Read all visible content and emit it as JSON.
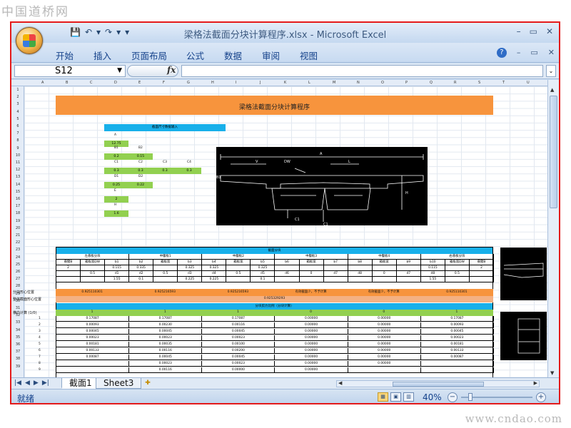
{
  "watermarks": {
    "top": "中国道桥网",
    "bottom": "www.cndao.com"
  },
  "window": {
    "title": "梁格法截面分块计算程序.xlsx - Microsoft Excel",
    "minimize": "–",
    "restore": "▭",
    "close": "✕"
  },
  "qat": {
    "save": "💾",
    "undo": "↶",
    "undo_dd": "▾",
    "redo": "↷",
    "redo_dd": "▾",
    "customize": "▾"
  },
  "ribbon": {
    "tabs": [
      "开始",
      "插入",
      "页面布局",
      "公式",
      "数据",
      "审阅",
      "视图"
    ],
    "help": "?",
    "min": "–",
    "restore": "▭",
    "close": "✕"
  },
  "formula_bar": {
    "name_box": "S12",
    "fx": "fx",
    "formula": ""
  },
  "columns": [
    "A",
    "B",
    "C",
    "D",
    "E",
    "F",
    "G",
    "H",
    "I",
    "J",
    "K",
    "L",
    "M",
    "N",
    "O",
    "P",
    "Q",
    "R",
    "S",
    "T",
    "U"
  ],
  "rows": [
    "1",
    "2",
    "3",
    "4",
    "5",
    "6",
    "7",
    "8",
    "9",
    "10",
    "11",
    "12",
    "13",
    "14",
    "15",
    "16",
    "17",
    "18",
    "19",
    "20",
    "21",
    "22",
    "23",
    "24",
    "25",
    "26",
    "27",
    "28",
    "29",
    "30",
    "31",
    "32",
    "33",
    "34",
    "35",
    "36",
    "37",
    "38",
    "39"
  ],
  "sheet": {
    "banner_title": "梁格法截面分块计算程序",
    "input_header": "截面尺寸数据输入",
    "params": [
      {
        "label": "A",
        "value": "12.75"
      },
      {
        "label": "B1",
        "value": "0.2"
      },
      {
        "label": "B2",
        "value": "0.15"
      },
      {
        "label": "C1",
        "value": "0.3"
      },
      {
        "label": "C2",
        "value": "0.3"
      },
      {
        "label": "C3",
        "value": "0.3"
      },
      {
        "label": "C4",
        "value": "0.3"
      },
      {
        "label": "D1",
        "value": "0.25"
      },
      {
        "label": "D2",
        "value": "0.22"
      },
      {
        "label": "E",
        "value": "2"
      },
      {
        "label": "H",
        "value": "1.6"
      }
    ],
    "section_header": "截面分块",
    "block_headers": [
      "左悬板分块",
      "中腹板1",
      "中腹板2",
      "中腹板3",
      "中腹板4",
      "右悬板分块"
    ],
    "sub_headers": [
      "悬臂B",
      "箱板宽DW",
      "b1",
      "b2",
      "箱板宽",
      "b3",
      "b4",
      "箱板宽",
      "b5",
      "b6",
      "箱板宽",
      "b7",
      "b8",
      "箱板宽",
      "b9",
      "b10",
      "箱板宽DW",
      "悬臂B"
    ],
    "row27": [
      "2",
      "",
      "0.115",
      "0.335",
      "",
      "0.325",
      "0.325",
      "",
      "0.325",
      "",
      "",
      "",
      "",
      "",
      "",
      "0.115",
      "",
      "2"
    ],
    "row28": [
      "",
      "0.5",
      "d1",
      "d2",
      "0.5",
      "d3",
      "d4",
      "0.5",
      "d5",
      "d6",
      "0",
      "d7",
      "d8",
      "0",
      "d7",
      "d8",
      "0.5",
      ""
    ],
    "row29": [
      "",
      "",
      "1.55",
      "0.1",
      "",
      "0.225",
      "0.225",
      "",
      "0.1",
      "",
      "",
      "",
      "",
      "",
      "",
      "1.55",
      "",
      ""
    ],
    "row30_label": "分块形心位置",
    "row30": [
      "0.925110301",
      "0.925216593",
      "0.925216593",
      "有效截面少，不予计算",
      "有效截面少，不予计算",
      "0.925110301"
    ],
    "row31_label": "整体截面形心位置",
    "row31_value": "0.925329293",
    "dist_header": "分块剪力比例（分块计算）",
    "row33_label": "横向计算 (1/0)",
    "row33": [
      "1",
      "1",
      "1",
      "0",
      "0",
      "1"
    ],
    "data_rows": [
      {
        "n": "1",
        "v": [
          "0.17087",
          "0.17087",
          "0.17087",
          "0.00000",
          "0.00000",
          "0.17087"
        ]
      },
      {
        "n": "2",
        "v": [
          "0.00093",
          "0.00230",
          "0.00116",
          "0.00000",
          "0.00000",
          "0.00093"
        ]
      },
      {
        "n": "3",
        "v": [
          "0.00045",
          "0.00045",
          "0.00045",
          "0.00000",
          "0.00000",
          "0.00045"
        ]
      },
      {
        "n": "4",
        "v": [
          "0.00023",
          "0.00023",
          "0.00023",
          "0.00000",
          "0.00000",
          "0.00023"
        ]
      },
      {
        "n": "5",
        "v": [
          "0.00181",
          "0.00035",
          "0.00100",
          "0.00000",
          "0.00000",
          "0.00181"
        ]
      },
      {
        "n": "6",
        "v": [
          "0.00133",
          "0.00116",
          "0.00200",
          "0.00000",
          "0.00000",
          "0.00133"
        ]
      },
      {
        "n": "7",
        "v": [
          "0.00087",
          "0.00045",
          "0.00045",
          "0.00000",
          "0.00000",
          "0.00087"
        ]
      },
      {
        "n": "8",
        "v": [
          "",
          "0.00023",
          "0.00023",
          "0.00000",
          "0.00000",
          ""
        ]
      },
      {
        "n": "9",
        "v": [
          "",
          "0.00116",
          "0.00000",
          "0.00000",
          "",
          ""
        ]
      }
    ]
  },
  "sheet_tabs": {
    "nav": [
      "|◀",
      "◀",
      "▶",
      "▶|"
    ],
    "tabs": [
      "截面1",
      "Sheet3"
    ],
    "active": "截面1"
  },
  "status": {
    "ready": "就绪",
    "zoom": "40%",
    "zoom_out": "−",
    "zoom_in": "+"
  },
  "colors": {
    "accent": "#e41a1a",
    "banner": "#f7943d",
    "header_blue": "#18b0ea",
    "input_green": "#92d050"
  }
}
